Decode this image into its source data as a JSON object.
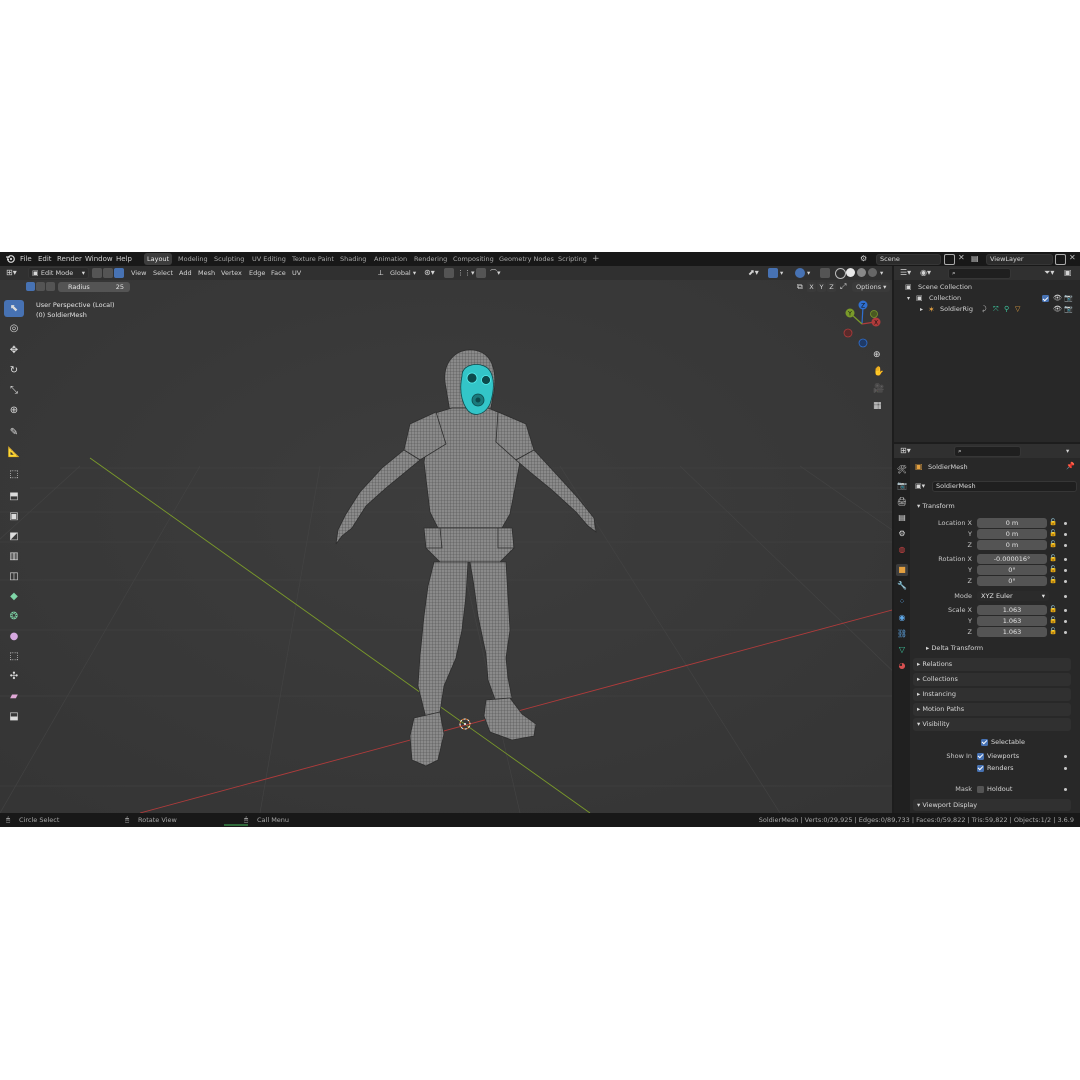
{
  "menu": {
    "items": [
      "File",
      "Edit",
      "Render",
      "Window",
      "Help"
    ]
  },
  "workspaces": [
    "Layout",
    "Modeling",
    "Sculpting",
    "UV Editing",
    "Texture Paint",
    "Shading",
    "Animation",
    "Rendering",
    "Compositing",
    "Geometry Nodes",
    "Scripting"
  ],
  "active_workspace": "Layout",
  "scene": {
    "name": "Scene"
  },
  "view_layer": {
    "name": "ViewLayer"
  },
  "viewport_header": {
    "mode": "Edit Mode",
    "menus": [
      "View",
      "Select",
      "Add",
      "Mesh",
      "Vertex",
      "Edge",
      "Face",
      "UV"
    ],
    "orientation": "Global",
    "options_label": "Options",
    "axes": [
      "X",
      "Y",
      "Z"
    ]
  },
  "tool_settings": {
    "radius_label": "Radius",
    "radius_value": "25"
  },
  "viewport_info": {
    "line1": "User Perspective (Local)",
    "line2": "(0) SoldierMesh"
  },
  "gizmo": {
    "x": "X",
    "y": "Y",
    "z": "Z"
  },
  "outliner": {
    "root": "Scene Collection",
    "collection": "Collection",
    "object": "SoldierRig"
  },
  "properties": {
    "object_name": "SoldierMesh",
    "data_name": "SoldierMesh",
    "transform": {
      "title": "Transform",
      "location_label": "Location X",
      "loc": [
        "0 m",
        "0 m",
        "0 m"
      ],
      "rotation_label": "Rotation X",
      "rot": [
        "-0.000016°",
        "0°",
        "0°"
      ],
      "mode_label": "Mode",
      "mode_value": "XYZ Euler",
      "scale_label": "Scale X",
      "scale": [
        "1.063",
        "1.063",
        "1.063"
      ],
      "y_label": "Y",
      "z_label": "Z"
    },
    "panels": [
      "Delta Transform",
      "Relations",
      "Collections",
      "Instancing",
      "Motion Paths",
      "Visibility"
    ],
    "visibility": {
      "selectable": "Selectable",
      "show_in": "Show In",
      "viewports": "Viewports",
      "renders": "Renders",
      "mask": "Mask",
      "holdout": "Holdout"
    },
    "viewport_display": "Viewport Display"
  },
  "statusbar": {
    "left1": "Circle Select",
    "left2": "Rotate View",
    "left3": "Call Menu",
    "stats": "SoldierMesh | Verts:0/29,925 | Edges:0/89,733 | Faces:0/59,822 | Tris:59,822 | Objects:1/2 | 3.6.9"
  },
  "colors": {
    "accent": "#4772b3",
    "x_axis": "#b03b3b",
    "y_axis": "#7a9a2a",
    "z_axis": "#2f6fd0",
    "viewport_bg": "#393939"
  }
}
